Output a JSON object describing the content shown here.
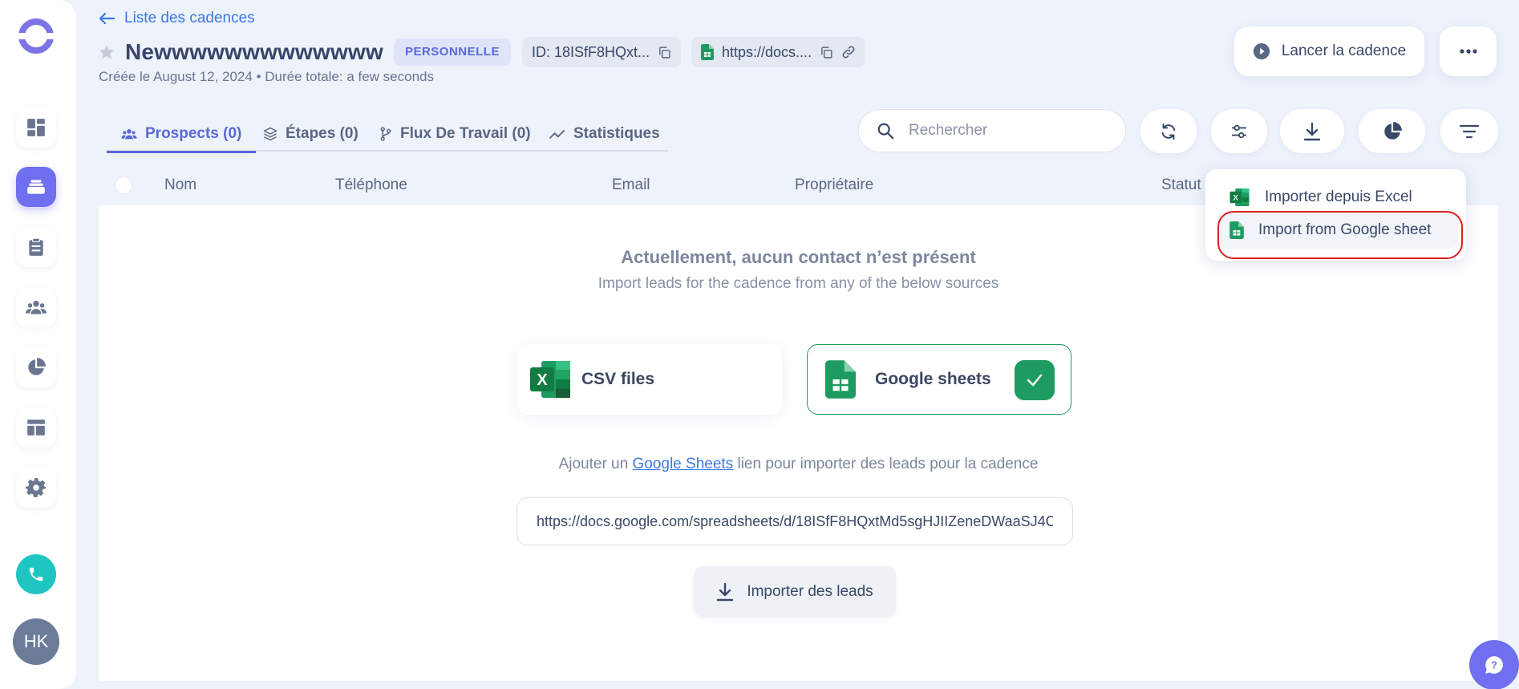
{
  "sidebar": {
    "items": [
      {
        "name": "dashboard",
        "icon": "dashboard-icon"
      },
      {
        "name": "cadences",
        "icon": "stack-icon",
        "active": true
      },
      {
        "name": "tasks",
        "icon": "clipboard-icon"
      },
      {
        "name": "people",
        "icon": "people-icon"
      },
      {
        "name": "analytics",
        "icon": "pie-icon"
      },
      {
        "name": "templates",
        "icon": "template-icon"
      },
      {
        "name": "settings",
        "icon": "gear-icon"
      }
    ],
    "phone_icon": "phone-icon",
    "avatar_initials": "HK"
  },
  "header": {
    "back_label": "Liste des cadences",
    "title": "Newwwwwwwwwwwww",
    "badge": "PERSONNELLE",
    "id_chip": "ID: 18ISfF8HQxt...",
    "link_chip": "https://docs....",
    "subtitle": "Créée le August 12, 2024 • Durée totale: a few seconds",
    "launch_label": "Lancer la cadence"
  },
  "tabs": [
    {
      "label": "Prospects (0)",
      "active": true
    },
    {
      "label": "Étapes (0)"
    },
    {
      "label": "Flux De Travail (0)"
    },
    {
      "label": "Statistiques"
    }
  ],
  "search": {
    "placeholder": "Rechercher"
  },
  "table": {
    "columns": [
      "Nom",
      "Téléphone",
      "Email",
      "Propriétaire",
      "Statut"
    ]
  },
  "empty_state": {
    "title": "Actuellement, aucun contact n’est présent",
    "subtitle": "Import leads for the cadence from any of the below sources",
    "sources": [
      {
        "label": "CSV files"
      },
      {
        "label": "Google sheets",
        "selected": true
      }
    ],
    "helper_prefix": "Ajouter un",
    "helper_link": "Google Sheets",
    "helper_suffix": "lien pour importer des leads pour la cadence",
    "url_value": "https://docs.google.com/spreadsheets/d/18ISfF8HQxtMd5sgHJIIZeneDWaaSJ4C",
    "import_label": "Importer des leads"
  },
  "dropdown": {
    "items": [
      {
        "label": "Importer depuis Excel"
      },
      {
        "label": "Import from Google sheet",
        "highlighted": true
      }
    ]
  },
  "colors": {
    "accent": "#5b68d8",
    "sidebar_active": "#6f6ff0",
    "link": "#3b79e6",
    "google_green": "#1e9b61",
    "phone": "#1fc6c1",
    "highlight_ring": "#e02020"
  }
}
